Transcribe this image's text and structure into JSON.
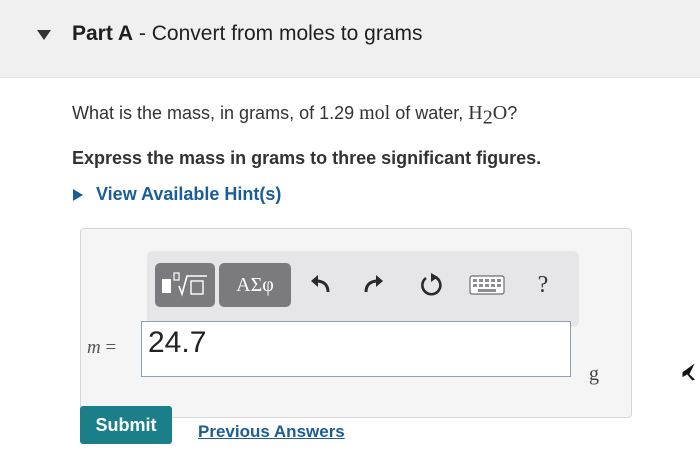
{
  "part": {
    "label": "Part A",
    "separator": " - ",
    "title": "Convert from moles to grams"
  },
  "question": {
    "prefix": "What is the mass, in grams, of 1.29 ",
    "unit": "mol",
    "middle": " of water, ",
    "formula_h": "H",
    "formula_sub": "2",
    "formula_o": "O",
    "suffix": "?"
  },
  "instruction": "Express the mass in grams to three significant figures.",
  "hint": {
    "label": "View Available Hint(s)"
  },
  "toolbar": {
    "greek_label": "ΑΣφ",
    "help_label": "?"
  },
  "answer": {
    "variable": "m",
    "equals": " =",
    "value": "24.7",
    "unit": "g"
  },
  "actions": {
    "submit_label": "Submit",
    "previous_answers_label": "Previous Answers"
  },
  "colors": {
    "link": "#1b5d96",
    "submit": "#1b7f89",
    "toolbar_button": "#7b7b7f"
  }
}
